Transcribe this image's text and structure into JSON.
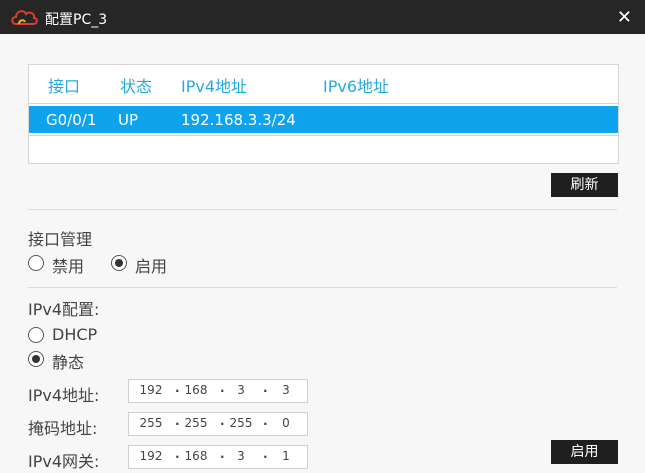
{
  "window": {
    "title": "配置PC_3",
    "close_glyph": "✕"
  },
  "table": {
    "headers": [
      "接口",
      "状态",
      "IPv4地址",
      "IPv6地址"
    ],
    "rows": [
      {
        "interface": "G0/0/1",
        "status": "UP",
        "ipv4": "192.168.3.3/24",
        "ipv6": ""
      }
    ],
    "selected_color": "#0fa3ee"
  },
  "buttons": {
    "refresh": "刷新",
    "apply": "启用"
  },
  "interface_mgmt": {
    "title": "接口管理",
    "disable": "禁用",
    "enable": "启用",
    "selected": "enable"
  },
  "ipv4_config": {
    "title": "IPv4配置:",
    "dhcp": "DHCP",
    "static": "静态",
    "selected": "static",
    "address_label": "IPv4地址:",
    "address": [
      "192",
      "168",
      "3",
      "3"
    ],
    "mask_label": "掩码地址:",
    "mask": [
      "255",
      "255",
      "255",
      "0"
    ],
    "gateway_label": "IPv4网关:",
    "gateway": [
      "192",
      "168",
      "3",
      "1"
    ],
    "separator": "."
  },
  "colors": {
    "accent": "#26a9e0",
    "titlebar": "#262626",
    "button": "#1f1f1f"
  }
}
